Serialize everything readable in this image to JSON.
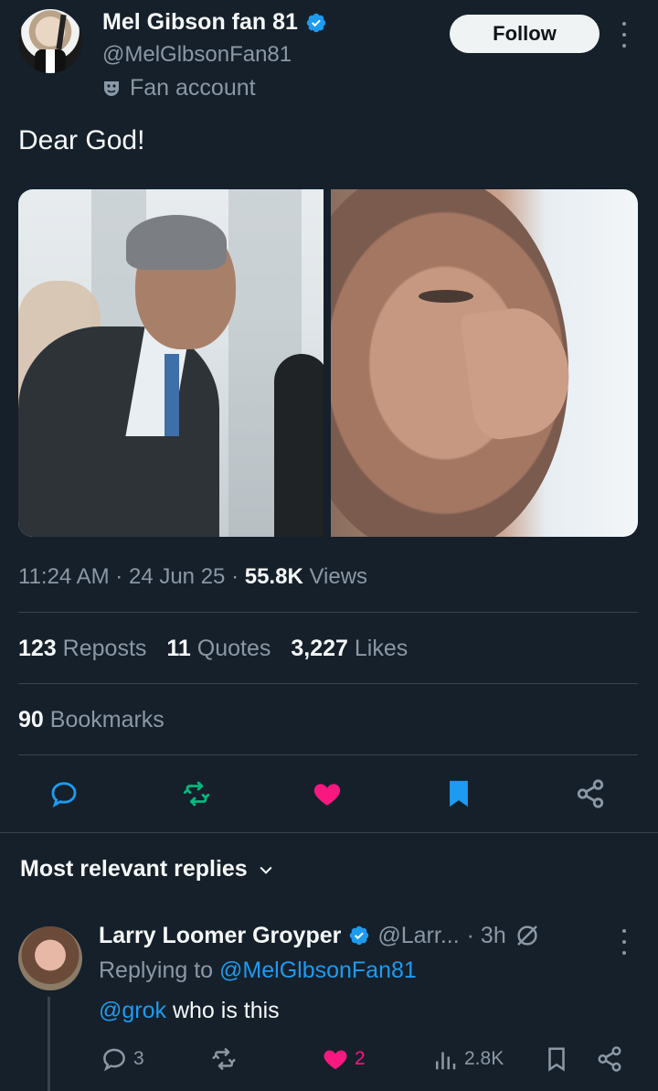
{
  "header": {
    "display_name": "Mel Gibson fan 81",
    "handle": "@MelGlbsonFan81",
    "badge_label": "Fan account",
    "follow_label": "Follow"
  },
  "tweet": {
    "text": "Dear God!",
    "time": "11:24 AM",
    "date": "24 Jun 25",
    "views_count": "55.8K",
    "views_label": "Views"
  },
  "stats": {
    "reposts_count": "123",
    "reposts_label": "Reposts",
    "quotes_count": "11",
    "quotes_label": "Quotes",
    "likes_count": "3,227",
    "likes_label": "Likes",
    "bookmarks_count": "90",
    "bookmarks_label": "Bookmarks"
  },
  "replies_section": {
    "title": "Most relevant replies"
  },
  "reply": {
    "name": "Larry Loomer Groyper",
    "handle": "@Larr...",
    "age": "· 3h",
    "replying_prefix": "Replying to",
    "replying_handle": "@MelGlbsonFan81",
    "mention": "@grok",
    "text": "who is this",
    "replies": "3",
    "likes": "2",
    "views": "2.8K"
  },
  "colors": {
    "background": "#15202b",
    "accent": "#1d9bf0",
    "like": "#f91880",
    "repost": "#00ba7c",
    "muted": "#8b98a5"
  }
}
